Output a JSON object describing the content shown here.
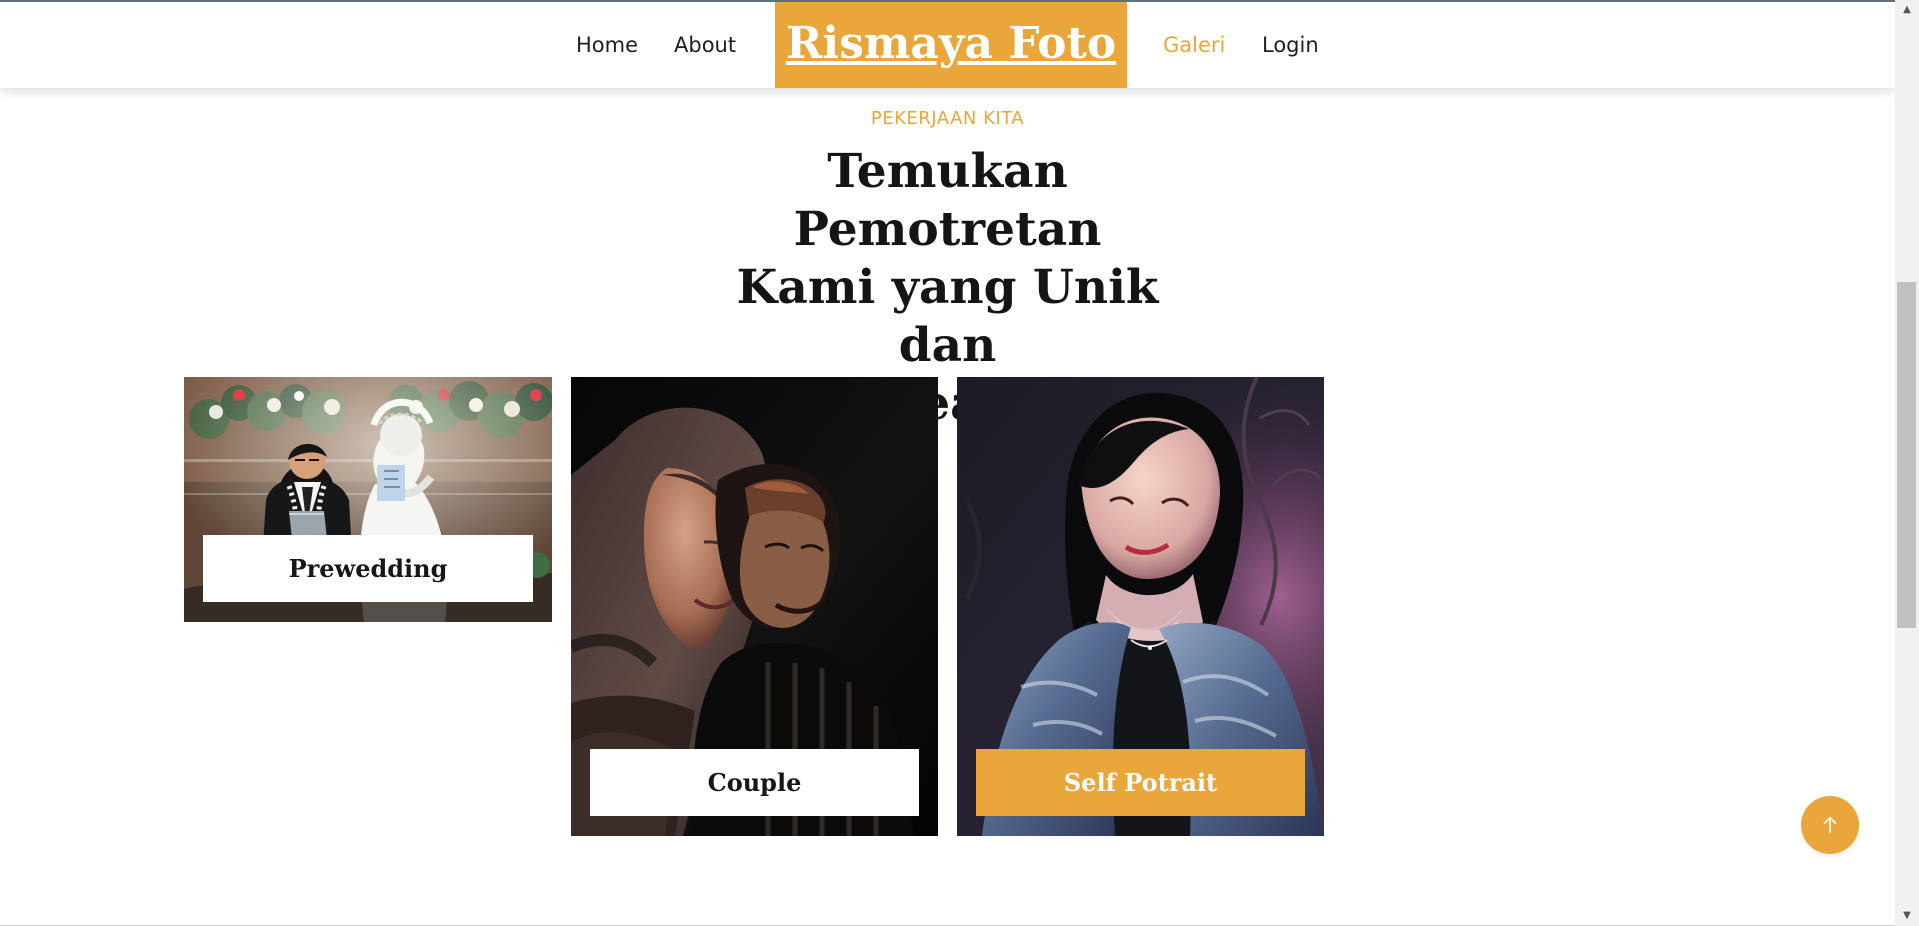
{
  "nav": {
    "home": "Home",
    "about": "About",
    "brand": "Rismaya Foto",
    "galeri": "Galeri",
    "login": "Login"
  },
  "section": {
    "eyebrow": "PEKERJAAN KITA",
    "title_line_1": "Temukan Pemotretan",
    "title_line_2": "Kami yang Unik dan",
    "title_line_3": "Kreatif"
  },
  "gallery": {
    "cards": [
      {
        "label": "Prewedding"
      },
      {
        "label": "Couple"
      },
      {
        "label": "Self Potrait"
      }
    ]
  },
  "theme": {
    "accent": "#e9a63a",
    "text": "#171717",
    "page_background": "#ffffff"
  },
  "icons": {
    "scroll_top": "arrow-up-icon"
  }
}
